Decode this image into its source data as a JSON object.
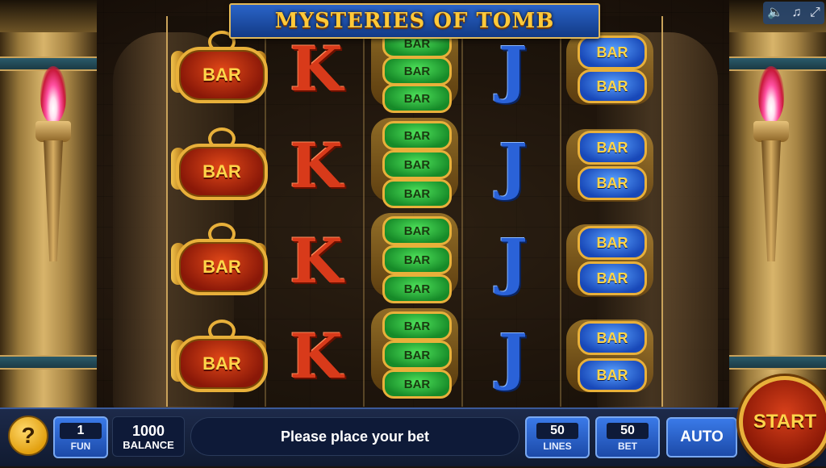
{
  "game": {
    "title": "MYSTERIES OF TOMB"
  },
  "system_icons": [
    {
      "name": "sound-icon",
      "glyph": "🔈"
    },
    {
      "name": "music-icon",
      "glyph": "♫"
    },
    {
      "name": "fullscreen-icon",
      "glyph": "⤢"
    }
  ],
  "reels": [
    [
      "BAR",
      "BAR",
      "BAR",
      "BAR"
    ],
    [
      "K",
      "K",
      "K",
      "K"
    ],
    [
      "BAR",
      "BAR",
      "BAR",
      "BAR"
    ],
    [
      "J",
      "J",
      "J",
      "J"
    ],
    [
      "BAR",
      "BAR",
      "BAR",
      "BAR"
    ]
  ],
  "symbols": {
    "bar": "BAR",
    "k": "K",
    "j": "J"
  },
  "bottom_bar": {
    "help_label": "?",
    "fun_value": "1",
    "fun_label": "FUN",
    "balance_value": "1000",
    "balance_label": "BALANCE",
    "message": "Please place your bet",
    "lines_value": "50",
    "lines_label": "LINES",
    "bet_value": "50",
    "bet_label": "BET",
    "auto_label": "AUTO",
    "start_label": "START"
  },
  "colors": {
    "title_gold": "#ffc93a",
    "banner_blue": "#1c4aa8",
    "bar_red": "#c8300e",
    "bar_green": "#2ab83a",
    "bar_blue": "#2a62d8",
    "k_red": "#d83a1a",
    "j_blue": "#2a62d8",
    "start_red": "#b02a10"
  }
}
